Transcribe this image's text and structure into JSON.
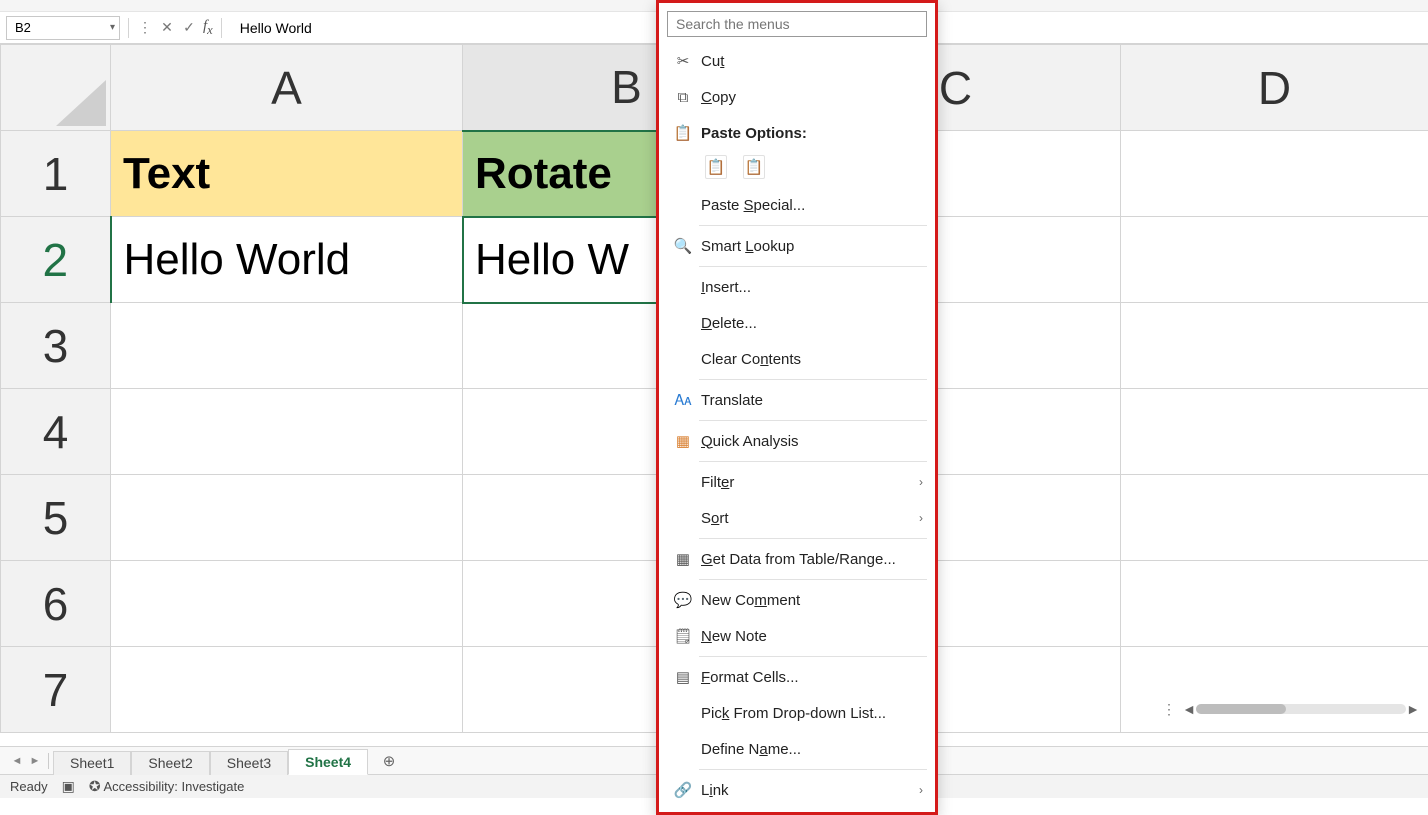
{
  "nameBox": "B2",
  "formulaBar": {
    "value": "Hello World"
  },
  "columns": [
    "A",
    "B",
    "C",
    "D"
  ],
  "rows": [
    "1",
    "2",
    "3",
    "4",
    "5",
    "6",
    "7"
  ],
  "activeRow": "2",
  "activeCol": "B",
  "cells": {
    "A1": "Text",
    "B1": "Rotate",
    "A2": "Hello World",
    "B2": "Hello W"
  },
  "contextMenu": {
    "searchPlaceholder": "Search the menus",
    "cut": "Cut",
    "copy": "Copy",
    "pasteOptionsLabel": "Paste Options:",
    "pasteSpecial": "Paste Special...",
    "smartLookup": "Smart Lookup",
    "insert": "Insert...",
    "delete": "Delete...",
    "clearContents": "Clear Contents",
    "translate": "Translate",
    "quickAnalysis": "Quick Analysis",
    "filter": "Filter",
    "sort": "Sort",
    "getData": "Get Data from Table/Range...",
    "newComment": "New Comment",
    "newNote": "New Note",
    "formatCells": "Format Cells...",
    "pickFromList": "Pick From Drop-down List...",
    "defineName": "Define Name...",
    "link": "Link"
  },
  "tabs": [
    "Sheet1",
    "Sheet2",
    "Sheet3",
    "Sheet4"
  ],
  "activeTab": "Sheet4",
  "status": {
    "ready": "Ready",
    "accessibility": "Accessibility: Investigate"
  }
}
